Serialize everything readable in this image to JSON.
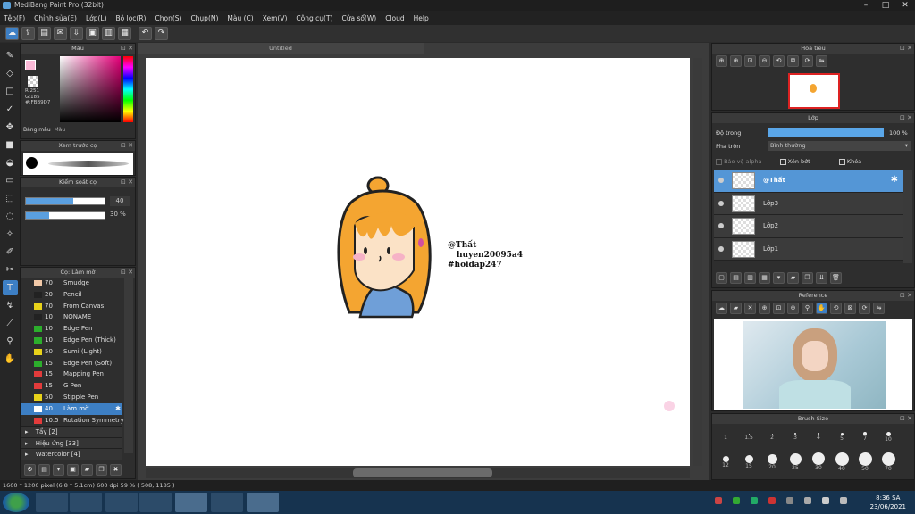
{
  "window": {
    "title": "MediBang Paint Pro (32bit)",
    "min": "–",
    "max": "□",
    "close": "✕"
  },
  "menu": [
    "Tệp(F)",
    "Chỉnh sửa(E)",
    "Lớp(L)",
    "Bộ lọc(R)",
    "Chọn(S)",
    "Chụp(N)",
    "Màu (C)",
    "Xem(V)",
    "Công cụ(T)",
    "Cửa sổ(W)",
    "Cloud",
    "Help"
  ],
  "color_panel": {
    "title": "Màu",
    "r": "R:251",
    "g": "G:185",
    "hex": "#:FBB9D7",
    "tab_palette": "Bảng màu",
    "tab_color": "Màu",
    "fg_color": "#fbb9d7"
  },
  "brush_preview": {
    "title": "Xem trước cọ"
  },
  "brush_control": {
    "title": "Kiểm soát cọ",
    "size_value": "40",
    "size_fraction": 0.6,
    "opacity_value": "30 %",
    "opacity_fraction": 0.3
  },
  "brush_list": {
    "title": "Cọ: Làm mờ",
    "items": [
      {
        "size": "70",
        "name": "Smudge",
        "color": "#f2c9a8"
      },
      {
        "size": "20",
        "name": "Pencil",
        "color": "#222222"
      },
      {
        "size": "70",
        "name": "From Canvas",
        "color": "#e8d21a"
      },
      {
        "size": "10",
        "name": "NONAME",
        "color": "#222222"
      },
      {
        "size": "10",
        "name": "Edge Pen",
        "color": "#2cae2c"
      },
      {
        "size": "10",
        "name": "Edge Pen (Thick)",
        "color": "#2cae2c"
      },
      {
        "size": "50",
        "name": "Sumi (Light)",
        "color": "#e8d21a"
      },
      {
        "size": "15",
        "name": "Edge Pen (Soft)",
        "color": "#2cae2c"
      },
      {
        "size": "15",
        "name": "Mapping Pen",
        "color": "#e23b3b"
      },
      {
        "size": "15",
        "name": "G Pen",
        "color": "#e23b3b"
      },
      {
        "size": "50",
        "name": "Stipple Pen",
        "color": "#e8d21a"
      },
      {
        "size": "40",
        "name": "Làm mờ",
        "color": "#ffffff",
        "selected": true
      },
      {
        "size": "10.5",
        "name": "Rotation Symmetry",
        "color": "#e23b3b"
      }
    ],
    "groups": [
      "Tẩy [2]",
      "Hiệu ứng [33]",
      "Watercolor [4]"
    ]
  },
  "document": {
    "tab": "Untitled",
    "caption_line1": "@Thất",
    "caption_line2": "huyen20095a4",
    "caption_line3": "#hoidap247"
  },
  "navigator": {
    "title": "Hoa tiêu"
  },
  "layer_panel": {
    "title": "Lớp",
    "opacity_label": "Độ trong",
    "opacity_value": "100 %",
    "blend_label": "Pha trộn",
    "blend_value": "Bình thường",
    "protect_alpha": "Bảo vệ alpha",
    "clipping": "Xén bớt",
    "lock": "Khóa",
    "layers": [
      {
        "name": "@Thất",
        "selected": true
      },
      {
        "name": "Lớp3"
      },
      {
        "name": "Lớp2"
      },
      {
        "name": "Lớp1"
      }
    ]
  },
  "reference": {
    "title": "Reference"
  },
  "brush_size": {
    "title": "Brush Size",
    "row1": [
      "1",
      "1.5",
      "2",
      "3",
      "4",
      "5",
      "7",
      "10"
    ],
    "row2": [
      "12",
      "15",
      "20",
      "25",
      "30",
      "40",
      "50",
      "70"
    ]
  },
  "status": {
    "text": "1600 * 1200 pixel  (6.8 * 5.1cm)  600 dpi  59 %  ( 508, 1185 )"
  },
  "taskbar": {
    "time": "8:36 SA",
    "date": "23/06/2021"
  }
}
